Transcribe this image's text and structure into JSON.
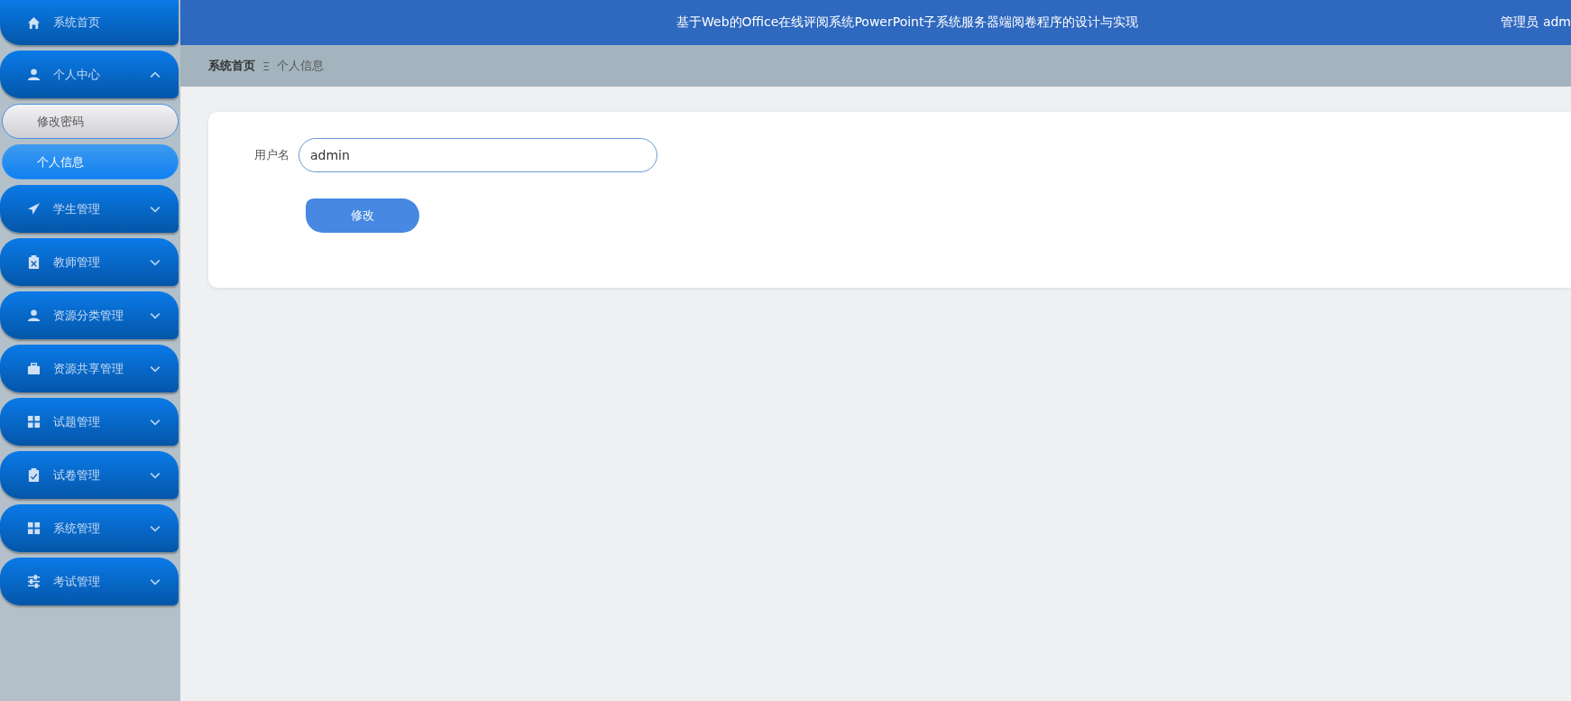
{
  "sidebar": {
    "items": [
      {
        "label": "系统首页",
        "kind": "link"
      },
      {
        "label": "个人中心",
        "kind": "menu",
        "expanded": true,
        "children": [
          {
            "label": "修改密码",
            "selected": false
          },
          {
            "label": "个人信息",
            "selected": true
          }
        ]
      },
      {
        "label": "学生管理",
        "kind": "menu",
        "expanded": false
      },
      {
        "label": "教师管理",
        "kind": "menu",
        "expanded": false
      },
      {
        "label": "资源分类管理",
        "kind": "menu",
        "expanded": false
      },
      {
        "label": "资源共享管理",
        "kind": "menu",
        "expanded": false
      },
      {
        "label": "试题管理",
        "kind": "menu",
        "expanded": false
      },
      {
        "label": "试卷管理",
        "kind": "menu",
        "expanded": false
      },
      {
        "label": "系统管理",
        "kind": "menu",
        "expanded": false
      },
      {
        "label": "考试管理",
        "kind": "menu",
        "expanded": false
      }
    ]
  },
  "header": {
    "title": "基于Web的Office在线评阅系统PowerPoint子系统服务器端阅卷程序的设计与实现",
    "user": "管理员 adm"
  },
  "breadcrumb": {
    "items": [
      "系统首页",
      "个人信息"
    ],
    "separator": "Ξ"
  },
  "form": {
    "fields": [
      {
        "label": "用户名",
        "value": "admin"
      }
    ],
    "submit": "修改"
  }
}
